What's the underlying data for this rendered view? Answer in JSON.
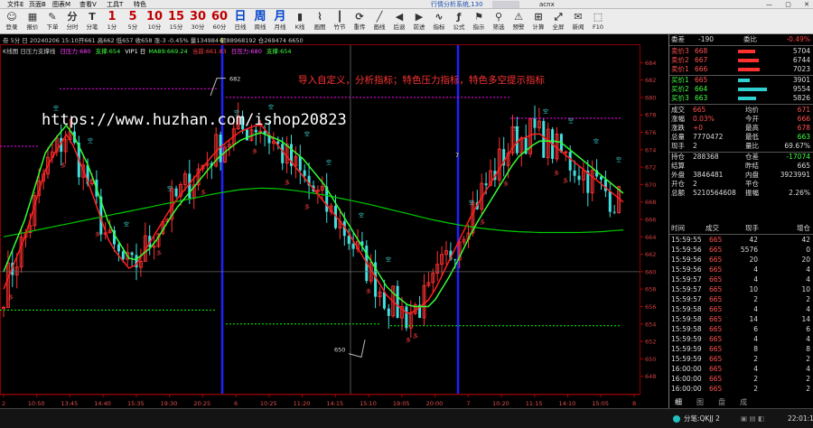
{
  "menu": [
    "文件E",
    "页面B",
    "图表M",
    "查看V",
    "工具T",
    "特色"
  ],
  "app_title": "行情分析系统,130",
  "account": "acnx",
  "window_controls": [
    "—",
    "▢",
    "✕"
  ],
  "toolbar": [
    {
      "label": "登录",
      "icon": "user-icon"
    },
    {
      "label": "报价",
      "icon": "quote-icon"
    },
    {
      "label": "下单",
      "icon": "order-icon"
    },
    {
      "label": "分时",
      "icon": "timeshare-icon"
    },
    {
      "label": "分笔",
      "icon": "tick-icon"
    },
    {
      "label": "1分",
      "period": "1"
    },
    {
      "label": "5分",
      "period": "5"
    },
    {
      "label": "10分",
      "period": "10"
    },
    {
      "label": "15分",
      "period": "15"
    },
    {
      "label": "30分",
      "period": "30"
    },
    {
      "label": "60分",
      "period": "60"
    },
    {
      "label": "日线",
      "period": "日"
    },
    {
      "label": "周线",
      "period": "周"
    },
    {
      "label": "月线",
      "period": "月"
    },
    {
      "label": "K线",
      "icon": "kline-icon"
    },
    {
      "label": "画图",
      "icon": "draw-icon"
    },
    {
      "label": "竹节",
      "icon": "bamboo-icon"
    },
    {
      "label": "重传",
      "icon": "resend-icon"
    },
    {
      "label": "画线",
      "icon": "line-icon"
    },
    {
      "label": "后退",
      "icon": "back-icon"
    },
    {
      "label": "前进",
      "icon": "forward-icon"
    },
    {
      "label": "指标",
      "icon": "indicator-icon"
    },
    {
      "label": "公式",
      "icon": "formula-icon"
    },
    {
      "label": "指示",
      "icon": "signal-icon"
    },
    {
      "label": "筛选",
      "icon": "filter-icon"
    },
    {
      "label": "预警",
      "icon": "alert-icon"
    },
    {
      "label": "计算",
      "icon": "calc-icon"
    },
    {
      "label": "全屏",
      "icon": "fullscreen-icon"
    },
    {
      "label": "新闻",
      "icon": "news-icon"
    },
    {
      "label": "F10",
      "icon": "f10-icon"
    }
  ],
  "chart_info": {
    "line1": "叁 5分 日 20240206 15:10开661 高662 低657 收658 涨-3 -0.45% 量134984 额88968192 仓269474 6650",
    "line2_prefix": "K线图 日压力支撑线",
    "pressure": "日压力:680",
    "support": "支撑:654",
    "vip": "VIP1 日",
    "ma": "MA89:669.24",
    "current": "当前:661.83",
    "pressure2": "日压力:680",
    "support2": "支撑:654"
  },
  "overlay": {
    "headline": "导入自定义，分析指标；特色压力指标，特色多空提示指标",
    "watermark": "https://www.huzhan.com/ishop20823",
    "high_label": "682",
    "low_label": "650",
    "sep_label_1": "6",
    "sep_label_2": "7"
  },
  "chart_data": {
    "type": "candlestick",
    "ylim": [
      646,
      686
    ],
    "yticks": [
      648,
      650,
      652,
      654,
      656,
      658,
      660,
      662,
      664,
      666,
      668,
      670,
      672,
      674,
      676,
      678,
      680,
      682,
      684
    ],
    "xticks": [
      "2",
      "10:50",
      "13:45",
      "14:40",
      "15:35",
      "19:30",
      "20:25",
      "6",
      "10:25",
      "11:20",
      "14:15",
      "15:10",
      "19:05",
      "20:00",
      "7",
      "10:20",
      "11:15",
      "14:10",
      "15:05",
      "8"
    ],
    "key_levels": {
      "pressure": 680,
      "support": 654,
      "high": 682,
      "low": 650
    },
    "signal_labels": {
      "long": "多",
      "short": "空"
    },
    "series": [
      {
        "name": "MA89",
        "color": "#00cc00",
        "values": [
          664,
          664.5,
          665,
          665.5,
          666,
          666.5,
          667,
          667.5,
          668,
          668.5,
          669,
          669.4,
          669.6,
          669.5,
          669.2,
          668.8,
          668.3,
          667.8,
          667.2,
          666.6,
          666,
          665.5,
          665.1,
          664.8,
          664.6,
          664.5,
          664.5,
          664.5,
          664.6,
          664.8
        ]
      },
      {
        "name": "短线",
        "color": "#ff2020",
        "values": [
          658,
          664,
          672,
          676,
          670,
          663,
          660,
          664,
          668,
          671,
          674,
          676,
          677,
          674,
          671,
          668,
          665,
          661,
          657,
          655,
          657,
          662,
          667,
          671,
          675,
          676,
          674,
          672,
          670,
          668
        ]
      },
      {
        "name": "中线",
        "color": "#33ff33",
        "values": [
          660,
          666,
          674,
          677,
          672,
          665,
          661,
          663,
          667,
          670,
          673,
          675,
          676,
          675,
          673,
          670,
          666,
          662,
          658,
          656,
          656,
          660,
          665,
          669,
          673,
          675,
          675,
          673,
          671,
          669
        ]
      }
    ],
    "ohlc_summary": "5-minute candles oscillating between 650 and 682"
  },
  "quote": {
    "header": [
      {
        "k": "委差",
        "v": "-190"
      },
      {
        "k": "委比",
        "v": "-0.49%"
      }
    ],
    "sells": [
      {
        "k": "卖价3",
        "p": "668",
        "v": "5704"
      },
      {
        "k": "卖价2",
        "p": "667",
        "v": "6744"
      },
      {
        "k": "卖价1",
        "p": "666",
        "v": "7023"
      }
    ],
    "buys": [
      {
        "k": "买价1",
        "p": "665",
        "v": "3901"
      },
      {
        "k": "买价2",
        "p": "664",
        "v": "9554"
      },
      {
        "k": "买价3",
        "p": "663",
        "v": "5826"
      }
    ],
    "stats": [
      [
        "成交",
        "665",
        "均价",
        "671"
      ],
      [
        "涨幅",
        "0.03%",
        "今开",
        "666"
      ],
      [
        "涨跌",
        "+0",
        "最高",
        "678"
      ],
      [
        "总量",
        "7770472",
        "最低",
        "663"
      ],
      [
        "现手",
        "2",
        "量比",
        "69.67%"
      ],
      [
        "持仓",
        "288368",
        "仓差",
        "-17074"
      ],
      [
        "结算",
        "",
        "昨结",
        "665"
      ],
      [
        "外盘",
        "3846481",
        "内盘",
        "3923991"
      ],
      [
        "开仓",
        "2",
        "平仓",
        ""
      ],
      [
        "总额",
        "5210564608",
        "振幅",
        "2.26%"
      ]
    ]
  },
  "ticks_header": [
    "时间",
    "成交",
    "现手",
    "增仓"
  ],
  "ticks": [
    [
      "15:59:55",
      "665",
      "42",
      "42"
    ],
    [
      "15:59:56",
      "665",
      "5576",
      "0"
    ],
    [
      "15:59:56",
      "665",
      "20",
      "20"
    ],
    [
      "15:59:56",
      "665",
      "4",
      "4"
    ],
    [
      "15:59:57",
      "665",
      "4",
      "4"
    ],
    [
      "15:59:57",
      "665",
      "10",
      "10"
    ],
    [
      "15:59:57",
      "665",
      "2",
      "2"
    ],
    [
      "15:59:58",
      "665",
      "4",
      "4"
    ],
    [
      "15:59:58",
      "665",
      "14",
      "14"
    ],
    [
      "15:59:58",
      "665",
      "6",
      "6"
    ],
    [
      "15:59:59",
      "665",
      "4",
      "4"
    ],
    [
      "15:59:59",
      "665",
      "8",
      "8"
    ],
    [
      "15:59:59",
      "665",
      "2",
      "2"
    ],
    [
      "16:00:00",
      "665",
      "4",
      "4"
    ],
    [
      "16:00:00",
      "665",
      "2",
      "2"
    ],
    [
      "16:00:00",
      "665",
      "2",
      "2"
    ]
  ],
  "tabs": [
    "细",
    "图",
    "盘",
    "成"
  ],
  "status": {
    "text": "分笔:QKJJ 2",
    "time": "22:01:13"
  },
  "colors": {
    "up": "#ff3030",
    "down": "#40e0e0",
    "ma89": "#00cc00",
    "pressure": "#ff00ff",
    "support": "#00ff00",
    "sep": "#2020ff"
  }
}
